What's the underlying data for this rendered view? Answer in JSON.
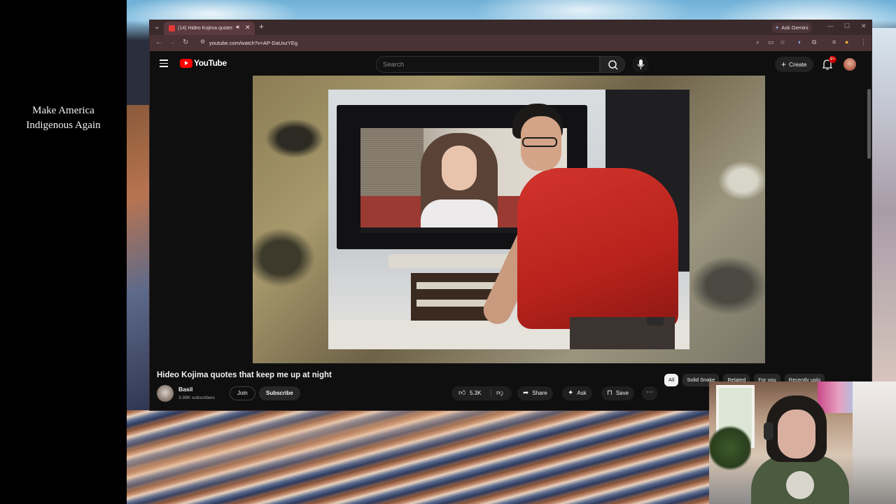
{
  "overlay": {
    "line1": "Make America",
    "line2": "Indigenous Again"
  },
  "browser": {
    "tab_title": "(14) Hideo Kojima quotes t",
    "url": "youtube.com/watch?v=AP-DaUxzYEg",
    "gemini_label": "Ask Gemini"
  },
  "youtube": {
    "logo_text": "YouTube",
    "search_placeholder": "Search",
    "create_label": "Create",
    "notifications_badge": "9+"
  },
  "video": {
    "title": "Hideo Kojima quotes that keep me up at night",
    "channel_name": "Basil",
    "subscribers": "3.99K subscribers",
    "join_label": "Join",
    "subscribe_label": "Subscribe",
    "like_count": "5.3K",
    "share_label": "Share",
    "ask_label": "Ask",
    "save_label": "Save"
  },
  "chips": [
    "All",
    "Solid Snake",
    "Related",
    "For you",
    "Recently uplo"
  ],
  "colors": {
    "youtube_red": "#ff0000",
    "page_bg": "#0f0f0f",
    "browser_chrome": "#3b2a2c"
  }
}
